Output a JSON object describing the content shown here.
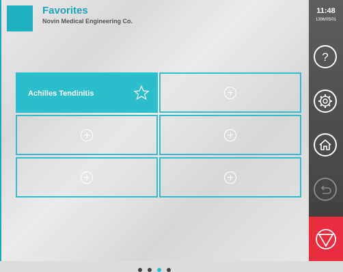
{
  "header": {
    "title": "Favorites",
    "subtitle": "Novin Medical Engineering Co."
  },
  "tiles": [
    {
      "label": "Achilles Tendinitis",
      "active": true
    },
    {
      "label": "",
      "active": false
    },
    {
      "label": "",
      "active": false
    },
    {
      "label": "",
      "active": false
    },
    {
      "label": "",
      "active": false
    },
    {
      "label": "",
      "active": false
    }
  ],
  "pagination": {
    "pages": 4,
    "current": 3
  },
  "sidebar": {
    "time": "11:48",
    "date": "1396/05/01",
    "help_icon": "question-icon",
    "settings_icon": "gear-icon",
    "home_icon": "home-icon",
    "back_icon": "back-arrow-icon",
    "stop_icon": "stop-triangle-icon"
  },
  "colors": {
    "accent": "#1fb1c2",
    "stop": "#ea2d3e",
    "sidebar": "#4a4a4a"
  }
}
